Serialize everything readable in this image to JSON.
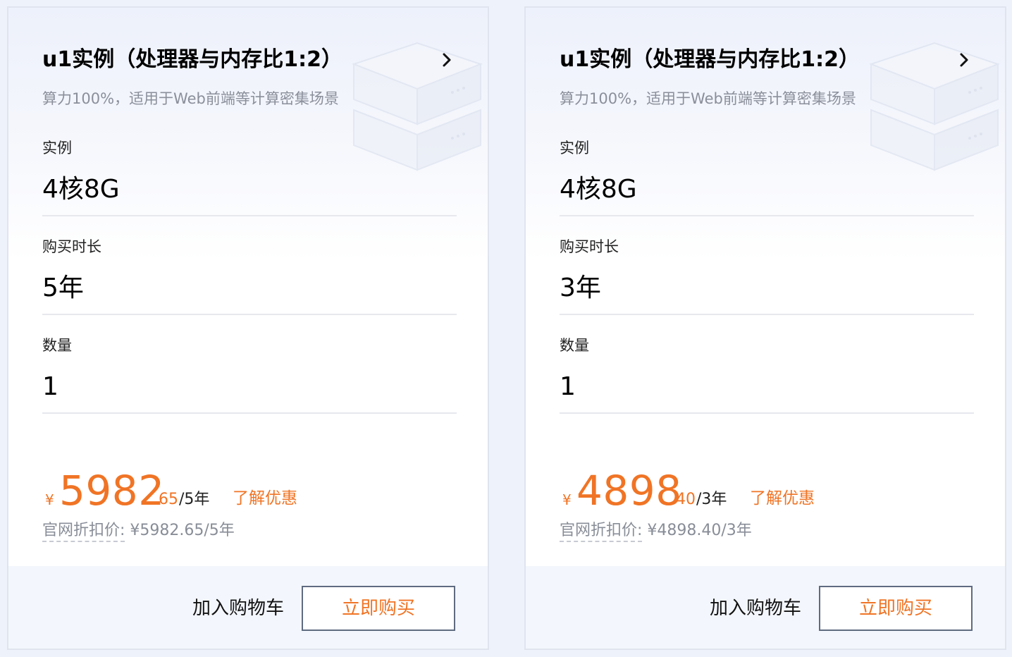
{
  "cards": [
    {
      "title": "u1实例（处理器与内存比1:2）",
      "subtitle": "算力100%，适用于Web前端等计算密集场景",
      "instance_label": "实例",
      "instance_value": "4核8G",
      "duration_label": "购买时长",
      "duration_value": "5年",
      "quantity_label": "数量",
      "quantity_value": "1",
      "currency_symbol": "¥",
      "price_integer": "5982",
      "price_decimal": ".65",
      "price_unit": "/5年",
      "promo_link": "了解优惠",
      "official_label": "官网折扣价:",
      "official_price": " ¥5982.65/5年",
      "add_to_cart": "加入购物车",
      "buy_now": "立即购买"
    },
    {
      "title": "u1实例（处理器与内存比1:2）",
      "subtitle": "算力100%，适用于Web前端等计算密集场景",
      "instance_label": "实例",
      "instance_value": "4核8G",
      "duration_label": "购买时长",
      "duration_value": "3年",
      "quantity_label": "数量",
      "quantity_value": "1",
      "currency_symbol": "¥",
      "price_integer": "4898",
      "price_decimal": ".40",
      "price_unit": "/3年",
      "promo_link": "了解优惠",
      "official_label": "官网折扣价:",
      "official_price": " ¥4898.40/3年",
      "add_to_cart": "加入购物车",
      "buy_now": "立即购买"
    }
  ],
  "icons": {
    "chevron": "chevron-right-icon",
    "decoration": "server-stack-illustration"
  },
  "colors": {
    "accent_orange": "#f07425",
    "muted_text": "#8a8f9a",
    "button_border": "#5f6b80",
    "page_background": "#eef2fb"
  }
}
